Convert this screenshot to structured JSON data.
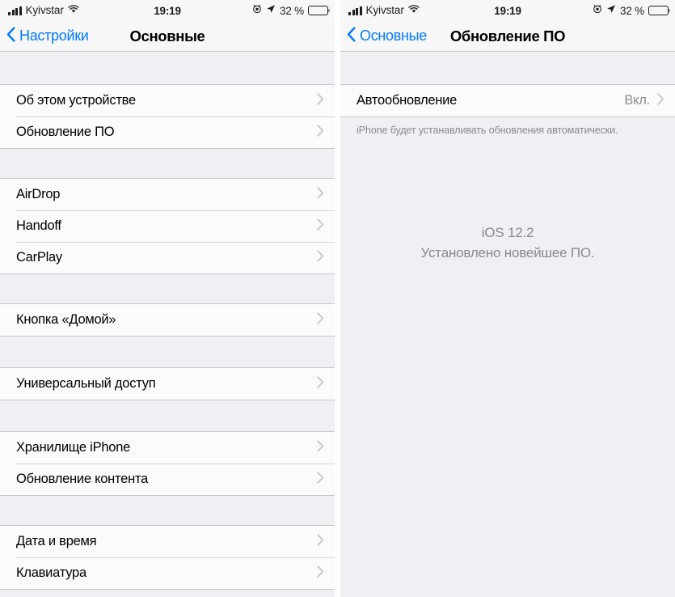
{
  "status_bar": {
    "carrier": "Kyivstar",
    "signal_bars": 4,
    "wifi_icon": "wifi-icon",
    "time": "19:19",
    "alarm_icon": "alarm-clock-icon",
    "location_icon": "location-arrow-icon",
    "battery_percent_label": "32 %",
    "battery_level": 32
  },
  "colors": {
    "accent_blue": "#007AFF",
    "separator": "#c8c7cc",
    "table_background": "#efeff4",
    "cell_background": "#fbfbfb",
    "secondary_text": "#8e8e93"
  },
  "left_panel": {
    "back_label": "Настройки",
    "title": "Основные",
    "sections": [
      {
        "rows": [
          {
            "label": "Об этом устройстве",
            "value": "",
            "accessory": "disclosure-chevron"
          },
          {
            "label": "Обновление ПО",
            "value": "",
            "accessory": "disclosure-chevron"
          }
        ]
      },
      {
        "rows": [
          {
            "label": "AirDrop",
            "value": "",
            "accessory": "disclosure-chevron"
          },
          {
            "label": "Handoff",
            "value": "",
            "accessory": "disclosure-chevron"
          },
          {
            "label": "CarPlay",
            "value": "",
            "accessory": "disclosure-chevron"
          }
        ]
      },
      {
        "rows": [
          {
            "label": "Кнопка «Домой»",
            "value": "",
            "accessory": "disclosure-chevron"
          }
        ]
      },
      {
        "rows": [
          {
            "label": "Универсальный доступ",
            "value": "",
            "accessory": "disclosure-chevron"
          }
        ]
      },
      {
        "rows": [
          {
            "label": "Хранилище iPhone",
            "value": "",
            "accessory": "disclosure-chevron"
          },
          {
            "label": "Обновление контента",
            "value": "",
            "accessory": "disclosure-chevron"
          }
        ]
      },
      {
        "rows": [
          {
            "label": "Дата и время",
            "value": "",
            "accessory": "disclosure-chevron"
          },
          {
            "label": "Клавиатура",
            "value": "",
            "accessory": "disclosure-chevron"
          }
        ]
      }
    ]
  },
  "right_panel": {
    "back_label": "Основные",
    "title": "Обновление ПО",
    "auto_update_row": {
      "label": "Автообновление",
      "value": "Вкл.",
      "accessory": "disclosure-chevron"
    },
    "footer_note": "iPhone будет устанавливать обновления автоматически.",
    "update_status": {
      "version": "iOS 12.2",
      "message": "Установлено новейшее ПО."
    }
  }
}
